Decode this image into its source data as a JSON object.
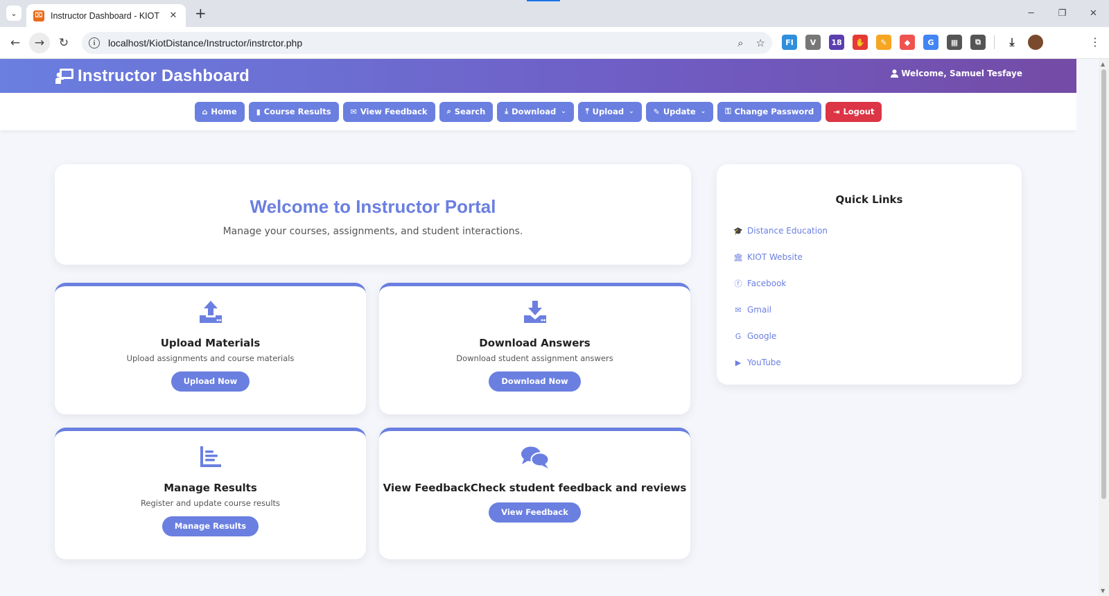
{
  "browser": {
    "tab_title": "Instructor Dashboard - KIOT",
    "tab_close": "✕",
    "new_tab": "+",
    "favicon": "⌧",
    "url": "localhost/KiotDistance/Instructor/instrctor.php",
    "info": "i",
    "extensions": [
      {
        "name": "ext-fi-icon",
        "label": "FI",
        "color": "#2f8fdc"
      },
      {
        "name": "ext-v-icon",
        "label": "V",
        "color": "#777777"
      },
      {
        "name": "ext-grad-icon",
        "label": "18",
        "color": "#5b3fb0"
      },
      {
        "name": "ext-hand-icon",
        "label": "✋",
        "color": "#e53935"
      },
      {
        "name": "ext-brush-icon",
        "label": "✎",
        "color": "#f6a623"
      },
      {
        "name": "ext-shield-icon",
        "label": "◆",
        "color": "#ef5350"
      },
      {
        "name": "ext-translate-icon",
        "label": "G",
        "color": "#4285f4"
      },
      {
        "name": "ext-qr-icon",
        "label": "▦",
        "color": "#555555"
      },
      {
        "name": "ext-puzzle-icon",
        "label": "⧉",
        "color": "#555555"
      }
    ]
  },
  "header": {
    "title": "Instructor Dashboard",
    "welcome": "Welcome, Samuel Tesfaye"
  },
  "nav": {
    "items": [
      {
        "name": "nav-home",
        "icon": "⌂",
        "label": "Home",
        "dropdown": false
      },
      {
        "name": "nav-course-results",
        "icon": "▮",
        "label": "Course Results",
        "dropdown": false
      },
      {
        "name": "nav-view-feedback",
        "icon": "✉",
        "label": "View Feedback",
        "dropdown": false
      },
      {
        "name": "nav-search",
        "icon": "⌕",
        "label": "Search",
        "dropdown": false
      },
      {
        "name": "nav-download",
        "icon": "⤓",
        "label": "Download",
        "dropdown": true
      },
      {
        "name": "nav-upload",
        "icon": "⤒",
        "label": "Upload",
        "dropdown": true
      },
      {
        "name": "nav-update",
        "icon": "✎",
        "label": "Update",
        "dropdown": true
      },
      {
        "name": "nav-change-password",
        "icon": "⚿",
        "label": "Change Password",
        "dropdown": false
      },
      {
        "name": "nav-logout",
        "icon": "⇥",
        "label": "Logout",
        "dropdown": false
      }
    ],
    "caret": "⌄"
  },
  "welcome_card": {
    "title": "Welcome to Instructor Portal",
    "subtitle": "Manage your courses, assignments, and student interactions."
  },
  "cards": [
    {
      "title": "Upload Materials",
      "desc": "Upload assignments and course materials",
      "button": "Upload Now"
    },
    {
      "title": "Download Answers",
      "desc": "Download student assignment answers",
      "button": "Download Now"
    },
    {
      "title": "Manage Results",
      "desc": "Register and update course results",
      "button": "Manage Results"
    },
    {
      "title": "View FeedbackCheck student feedback and reviews",
      "desc": "",
      "button": "View Feedback"
    }
  ],
  "quick_links": {
    "title": "Quick Links",
    "items": [
      {
        "name": "quick-link-distance-education",
        "icon": "🎓",
        "label": "Distance Education"
      },
      {
        "name": "quick-link-kiot-website",
        "icon": "🏛",
        "label": "KIOT Website"
      },
      {
        "name": "quick-link-facebook",
        "icon": "ⓕ",
        "label": "Facebook"
      },
      {
        "name": "quick-link-gmail",
        "icon": "✉",
        "label": "Gmail"
      },
      {
        "name": "quick-link-google",
        "icon": "G",
        "label": "Google"
      },
      {
        "name": "quick-link-youtube",
        "icon": "▶",
        "label": "YouTube"
      }
    ]
  },
  "colors": {
    "accent": "#6a7fe0",
    "header_end": "#744ba6",
    "logout": "#dc3545"
  }
}
